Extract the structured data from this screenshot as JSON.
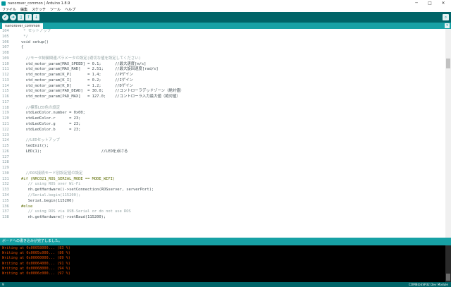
{
  "window": {
    "title": "nanorover_common | Arduino 1.8.9",
    "minimize": "─",
    "maximize": "□",
    "close": "✕"
  },
  "menu": [
    "ファイル",
    "編集",
    "スケッチ",
    "ツール",
    "ヘルプ"
  ],
  "toolbar": {
    "verify": "✔",
    "upload": "➔",
    "new": "▯",
    "open": "↑",
    "save": "↓",
    "serial_monitor": "⌕"
  },
  "tab": {
    "label": "nanorover_common",
    "menu_icon": "▾"
  },
  "editor": {
    "lines": [
      {
        "n": "104",
        "code": " * セットアップ"
      },
      {
        "n": "105",
        "code": " */"
      },
      {
        "n": "106",
        "code": "void setup()"
      },
      {
        "n": "107",
        "code": "{"
      },
      {
        "n": "108",
        "code": ""
      },
      {
        "n": "109",
        "code": "  //モータ制御関連パラメータの設定(適切な値を設定してください)"
      },
      {
        "n": "110",
        "code": "  std_motor_param[MAX_SPEED] = 0.1;      //最大速度[m/s]"
      },
      {
        "n": "111",
        "code": "  std_motor_param[MAX_RAD]   = 2.51;     //最大旋回速度[rad/s]"
      },
      {
        "n": "112",
        "code": "  std_motor_param[K_P]       = 1.4;      //Pゲイン"
      },
      {
        "n": "113",
        "code": "  std_motor_param[K_I]       = 0.2;      //Iゲイン"
      },
      {
        "n": "114",
        "code": "  std_motor_param[K_D]       = 1.2;      //Dゲイン"
      },
      {
        "n": "115",
        "code": "  std_motor_param[PAD_DEAD]  = 30.0;     //コントローラデッドゾーン（絶対値）"
      },
      {
        "n": "116",
        "code": "  std_motor_param[PAD_MAX]   = 127.0;    //コントローラ入力最大値（絶対値）"
      },
      {
        "n": "117",
        "code": ""
      },
      {
        "n": "118",
        "code": "  //標準LED色の設定"
      },
      {
        "n": "119",
        "code": "  stdLedColor.number = 0x00;"
      },
      {
        "n": "120",
        "code": "  stdLedColor.r      = 23;"
      },
      {
        "n": "121",
        "code": "  stdLedColor.g      = 23;"
      },
      {
        "n": "122",
        "code": "  stdLedColor.b      = 23;"
      },
      {
        "n": "123",
        "code": ""
      },
      {
        "n": "124",
        "code": "  //LEDセットアップ"
      },
      {
        "n": "125",
        "code": "  ledInit();"
      },
      {
        "n": "126",
        "code": "  LED(1);                          //LEDを点ける"
      },
      {
        "n": "127",
        "code": ""
      },
      {
        "n": "128",
        "code": ""
      },
      {
        "n": "129",
        "code": ""
      },
      {
        "n": "130",
        "code": "  //ROS接続モード別設定値の設定"
      },
      {
        "n": "131",
        "code": "#if (NRC021_ROS_SERIAL_MODE == MODE_WIFI)"
      },
      {
        "n": "132",
        "code": "   // using ROS over Wi-Fi"
      },
      {
        "n": "133",
        "code": "   nh.getHardware()->setConnection(ROSserver, serverPort);"
      },
      {
        "n": "134",
        "code": "   //Serial.begin(115200);"
      },
      {
        "n": "135",
        "code": "   Serial.begin(115200)"
      },
      {
        "n": "136",
        "code": "#else"
      },
      {
        "n": "137",
        "code": "   // using ROS via USB-Serial or do not use ROS"
      },
      {
        "n": "138",
        "code": "   nh.getHardware()->setBaud(115200);"
      }
    ]
  },
  "status": {
    "message": "ボードへの書き込みが完了しました。"
  },
  "console": {
    "lines": [
      "Writing at 0x00058000... (83 %)",
      "Writing at 0x0005c000... (86 %)",
      "Writing at 0x00060000... (89 %)",
      "Writing at 0x00064000... (91 %)",
      "Writing at 0x00068000... (94 %)",
      "Writing at 0x0006c000... (97 %)"
    ]
  },
  "bottom": {
    "line_number": "9",
    "board": "COM8のESP32 Dev Module"
  },
  "colors": {
    "toolbar": "#006468",
    "tabbar": "#17a1a5",
    "console_text": "#e34c00"
  }
}
